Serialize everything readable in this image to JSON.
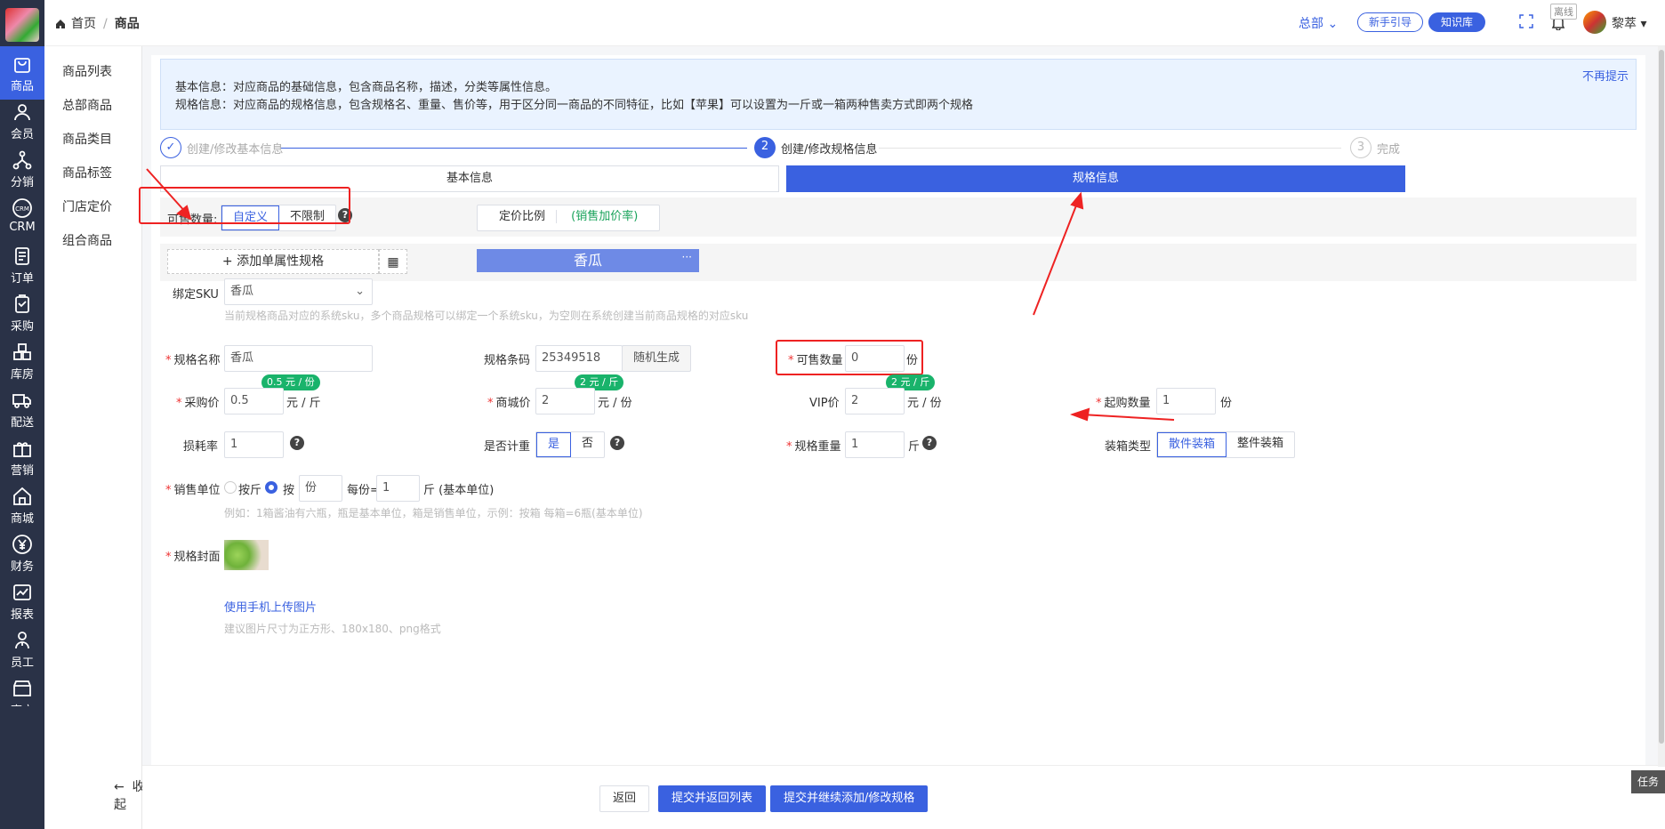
{
  "rail": {
    "items": [
      {
        "label": "商品",
        "icon": "shopping-bag-icon"
      },
      {
        "label": "会员",
        "icon": "user-icon"
      },
      {
        "label": "分销",
        "icon": "share-tree-icon"
      },
      {
        "label": "CRM",
        "icon": "crm-icon"
      },
      {
        "label": "订单",
        "icon": "order-icon"
      },
      {
        "label": "采购",
        "icon": "purchase-icon"
      },
      {
        "label": "库房",
        "icon": "warehouse-icon"
      },
      {
        "label": "配送",
        "icon": "delivery-icon"
      },
      {
        "label": "营销",
        "icon": "gift-icon"
      },
      {
        "label": "商城",
        "icon": "store-icon"
      },
      {
        "label": "财务",
        "icon": "yen-icon"
      },
      {
        "label": "报表",
        "icon": "chart-icon"
      },
      {
        "label": "员工",
        "icon": "staff-icon"
      },
      {
        "label": "商户",
        "icon": "merchant-icon"
      }
    ]
  },
  "subnav": {
    "items": [
      "商品列表",
      "总部商品",
      "商品类目",
      "商品标签",
      "门店定价",
      "组合商品"
    ],
    "collapse": "收起"
  },
  "header": {
    "home": "首页",
    "current": "商品",
    "hq": "总部",
    "guide": "新手引导",
    "kb": "知识库",
    "offline": "离线",
    "user": "黎萃"
  },
  "tip": {
    "line1": "基本信息：对应商品的基础信息，包含商品名称，描述，分类等属性信息。",
    "line2": "规格信息：对应商品的规格信息，包含规格名、重量、售价等，用于区分同一商品的不同特征，比如【苹果】可以设置为一斤或一箱两种售卖方式即两个规格",
    "dismiss": "不再提示"
  },
  "steps": {
    "s1": "创建/修改基本信息",
    "s2_num": "2",
    "s2": "创建/修改规格信息",
    "s3_num": "3",
    "s3": "完成"
  },
  "tabs": {
    "basic": "基本信息",
    "spec": "规格信息"
  },
  "sellable": {
    "label": "可售数量:",
    "custom": "自定义",
    "unlimited": "不限制",
    "pricing_ratio": "定价比例",
    "pricing_ratio_sub": "(销售加价率)"
  },
  "spec_bar": {
    "add": "+ 添加单属性规格",
    "spec_name": "香瓜",
    "more": "···"
  },
  "form": {
    "sku_label": "绑定SKU",
    "sku_value": "香瓜",
    "sku_hint": "当前规格商品对应的系统sku，多个商品规格可以绑定一个系统sku，为空则在系统创建当前商品规格的对应sku",
    "name_label": "规格名称",
    "name_value": "香瓜",
    "barcode_label": "规格条码",
    "barcode_value": "25349518",
    "random_btn": "随机生成",
    "qty_label": "可售数量",
    "qty_value": "0",
    "qty_unit": "份",
    "cost_pill": "0.5 元 / 份",
    "cost_label": "采购价",
    "cost_value": "0.5",
    "cost_unit": "元 / 斤",
    "mall_pill": "2 元 / 斤",
    "mall_label": "商城价",
    "mall_value": "2",
    "mall_unit": "元 / 份",
    "vip_pill": "2 元 / 斤",
    "vip_label": "VIP价",
    "vip_value": "2",
    "vip_unit": "元 / 份",
    "min_label": "起购数量",
    "min_value": "1",
    "min_unit": "份",
    "loss_label": "损耗率",
    "loss_value": "1",
    "weigh_label": "是否计重",
    "weigh_yes": "是",
    "weigh_no": "否",
    "weight_label": "规格重量",
    "weight_value": "1",
    "weight_unit": "斤",
    "pack_label": "装箱类型",
    "pack_loose": "散件装箱",
    "pack_whole": "整件装箱",
    "unit_label": "销售单位",
    "unit_by_jin": "按斤",
    "unit_by": "按",
    "unit_value": "份",
    "per_label": "每份=",
    "per_value": "1",
    "per_unit": "斤 (基本单位)",
    "unit_hint": "例如：1箱酱油有六瓶，瓶是基本单位，箱是销售单位，示例：按箱 每箱=6瓶(基本单位)",
    "cover_label": "规格封面",
    "upload_link": "使用手机上传图片",
    "cover_hint": "建议图片尺寸为正方形、180x180、png格式"
  },
  "footer": {
    "back": "返回",
    "submit_return": "提交并返回列表",
    "submit_continue": "提交并继续添加/修改规格"
  },
  "task": "任务",
  "colors": {
    "primary": "#3a61e0",
    "rail": "#2a3247",
    "annotation": "#e22",
    "pill": "#19b36b"
  }
}
